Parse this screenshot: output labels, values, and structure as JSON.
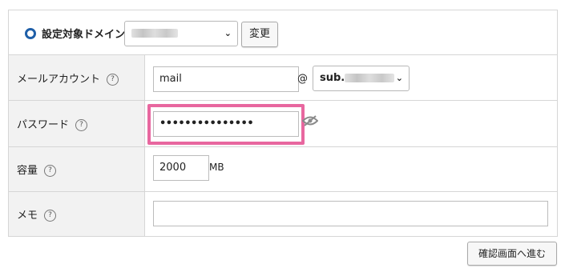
{
  "domain": {
    "label": "設定対象ドメイン",
    "selected_value": "",
    "change_button": "変更"
  },
  "rows": {
    "mail_account": {
      "label": "メールアカウント",
      "help": "?",
      "local_part": "mail",
      "at": "@",
      "domain_prefix": "sub."
    },
    "password": {
      "label": "パスワード",
      "help": "?",
      "value": "•••••••••••••••"
    },
    "capacity": {
      "label": "容量",
      "help": "?",
      "value": "2000",
      "unit": "MB"
    },
    "memo": {
      "label": "メモ",
      "help": "?",
      "value": ""
    }
  },
  "confirm_button": "確認画面へ進む",
  "colors": {
    "highlight": "#e8679f",
    "radio": "#1f5fa8",
    "label_bg": "#f2f2f2"
  }
}
